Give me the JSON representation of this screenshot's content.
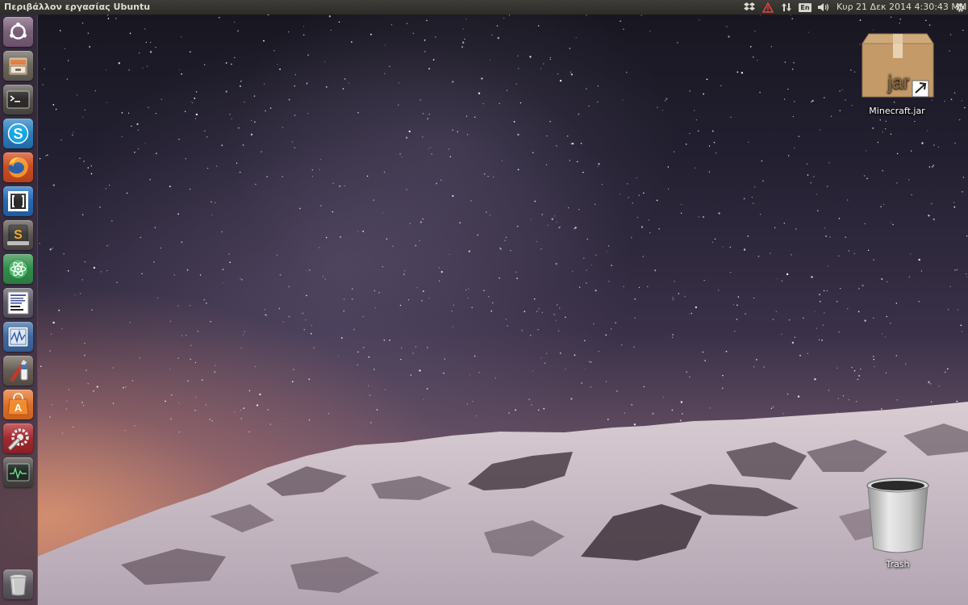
{
  "top_panel": {
    "title": "Περιβάλλον εργασίας Ubuntu",
    "indicators": {
      "dropbox_icon": "dropbox-icon",
      "alert_icon": "warning-icon",
      "network_icon": "network-updown-icon",
      "language": "En",
      "sound_icon": "speaker-icon",
      "power_icon": "gear-icon"
    },
    "clock": "Κυρ 21 Δεκ 2014  4:30:43 ΜΜ"
  },
  "launcher": {
    "items": [
      {
        "name": "dash-home",
        "icon": "ubuntu-logo-icon"
      },
      {
        "name": "files",
        "icon": "file-cabinet-icon"
      },
      {
        "name": "terminal",
        "icon": "terminal-icon"
      },
      {
        "name": "skype",
        "icon": "skype-icon",
        "glyph": "S"
      },
      {
        "name": "firefox",
        "icon": "firefox-icon"
      },
      {
        "name": "brackets",
        "icon": "brackets-icon"
      },
      {
        "name": "sublime-text",
        "icon": "sublime-text-icon",
        "glyph": "S"
      },
      {
        "name": "atom",
        "icon": "atom-icon"
      },
      {
        "name": "document-viewer",
        "icon": "document-thumbnail-icon"
      },
      {
        "name": "system-monitor",
        "icon": "monitor-graph-icon"
      },
      {
        "name": "gimp",
        "icon": "paint-tools-icon"
      },
      {
        "name": "software-center",
        "icon": "shopping-bag-icon",
        "glyph": "A"
      },
      {
        "name": "system-settings",
        "icon": "wrench-gear-icon"
      },
      {
        "name": "system-monitor-2",
        "icon": "activity-monitor-icon"
      }
    ],
    "trash_icon": "trash-icon"
  },
  "desktop": {
    "icons": [
      {
        "label": "Minecraft.jar",
        "icon": "jar-package-icon",
        "badge": "jar"
      },
      {
        "label": "Trash",
        "icon": "trash-bin-icon"
      }
    ]
  },
  "colors": {
    "panel": "#2d2c28",
    "launcher": "#3c3042",
    "ubuntu_orange": "#dd4814",
    "skype_blue": "#12a5e8",
    "firefox_orange": "#e66a1c",
    "atom_green": "#3a9e55",
    "software_center_orange": "#e8741c"
  }
}
